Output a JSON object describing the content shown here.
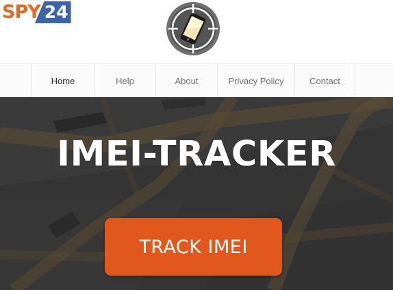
{
  "brand": {
    "logo_text": "SPY",
    "logo_number": "24"
  },
  "nav": {
    "items": [
      {
        "label": "Home",
        "active": true
      },
      {
        "label": "Help",
        "active": false
      },
      {
        "label": "About",
        "active": false
      },
      {
        "label": "Privacy Policy",
        "active": false
      },
      {
        "label": "Contact",
        "active": false
      }
    ]
  },
  "hero": {
    "title": "IMEI-TRACKER",
    "button_label": "TRACK IMEI"
  },
  "colors": {
    "brand_orange": "#e86a22",
    "brand_blue": "#3d63a8",
    "button_orange": "#e2571b",
    "hero_dark": "#3a3a3a"
  },
  "icons": [
    "phone-target-icon"
  ]
}
